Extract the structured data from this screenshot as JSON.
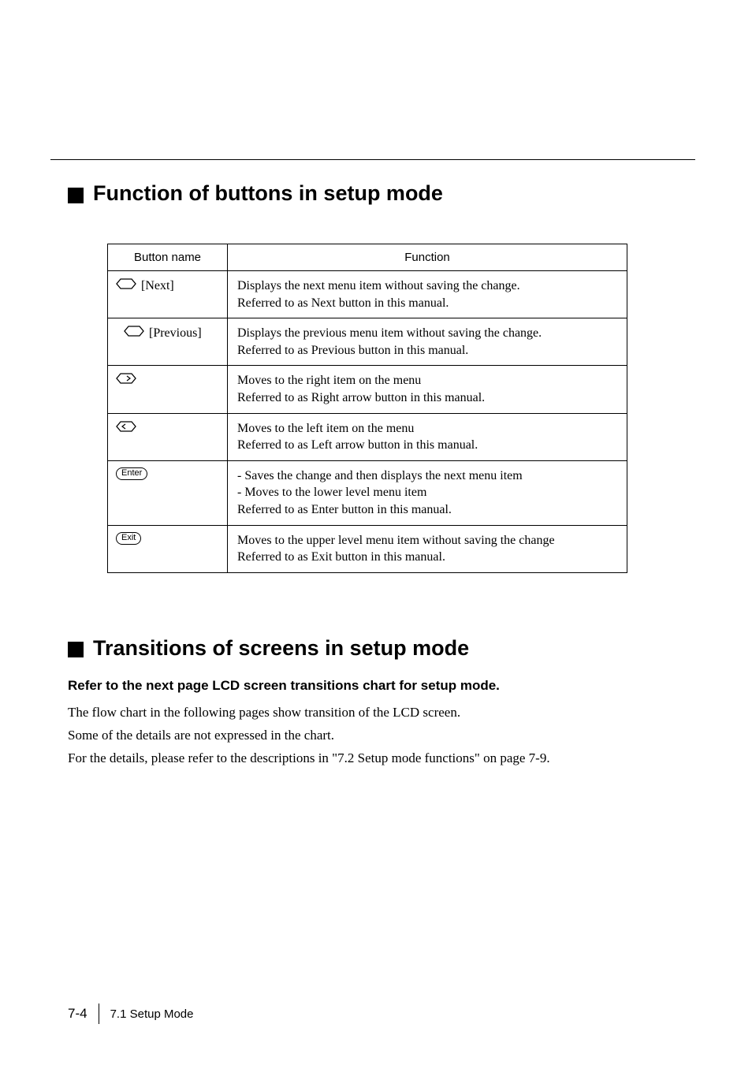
{
  "heading1": "Function of buttons in setup mode",
  "table": {
    "header": {
      "col1": "Button name",
      "col2": "Function"
    },
    "rows": [
      {
        "name": "[Next]",
        "func": "Displays the next menu item without saving the change.\nReferred to as Next button in this manual."
      },
      {
        "name": "[Previous]",
        "func": "Displays the previous menu item without saving the change.\nReferred to as Previous button in this manual."
      },
      {
        "name": "",
        "func": "Moves to the right item on the menu\nReferred to as Right arrow button in this manual."
      },
      {
        "name": "",
        "func": "Moves to the left item on the menu\nReferred to as Left arrow button in this manual."
      },
      {
        "name": "Enter",
        "func": "- Saves the change and then displays the next menu item\n- Moves to the lower level menu item\nReferred to as Enter button in this manual."
      },
      {
        "name": "Exit",
        "func": "Moves to the upper level menu item without saving the change\nReferred to as Exit button in this manual."
      }
    ]
  },
  "heading2": "Transitions of screens in setup mode",
  "sub_bold": "Refer to the next page LCD screen transitions chart for setup mode.",
  "para1": "The flow chart in the following pages show transition of the LCD screen.",
  "para2": "Some of the details are not expressed in the chart.",
  "para3": "For the details, please refer to the descriptions in \"7.2  Setup mode functions\" on page 7-9.",
  "footer": {
    "page": "7-4",
    "section": "7.1 Setup Mode"
  }
}
